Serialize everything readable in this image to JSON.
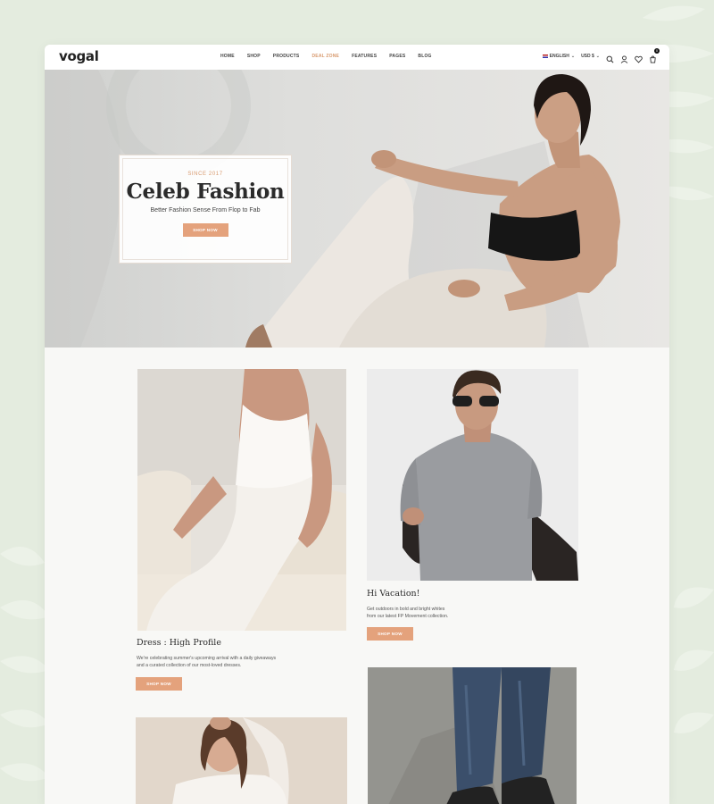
{
  "brand": {
    "logo": "vogal"
  },
  "nav": {
    "items": [
      "HOME",
      "SHOP",
      "PRODUCTS",
      "DEAL ZONE",
      "FEATURES",
      "PAGES",
      "BLOG"
    ],
    "active_index": 3
  },
  "header_tools": {
    "language": "ENGLISH",
    "currency": "USD $",
    "cart_count": "0",
    "icons": [
      "search-icon",
      "user-icon",
      "heart-icon",
      "cart-icon"
    ]
  },
  "hero": {
    "eyebrow": "SINCE 2017",
    "title": "Celeb Fashion",
    "subtitle": "Better Fashion Sense From Flop to Fab",
    "button": "SHOP NOW"
  },
  "cards": [
    {
      "title": "Dress : High Profile",
      "desc_line1": "We're celebrating summer's upcoming arrival with a daily giveaways",
      "desc_line2": "and a curated collection of our most-loved dresses.",
      "button": "SHOP NOW"
    },
    {
      "title": "Hi Vacation!",
      "desc_line1": "Get outdoors in bold and bright whites",
      "desc_line2": "from our latest FP Movement collection.",
      "button": "SHOP NOW"
    }
  ],
  "colors": {
    "accent": "#e4a27c",
    "nav_active": "#d89a6e",
    "background": "#e4ecdf",
    "page": "#f8f8f6"
  }
}
